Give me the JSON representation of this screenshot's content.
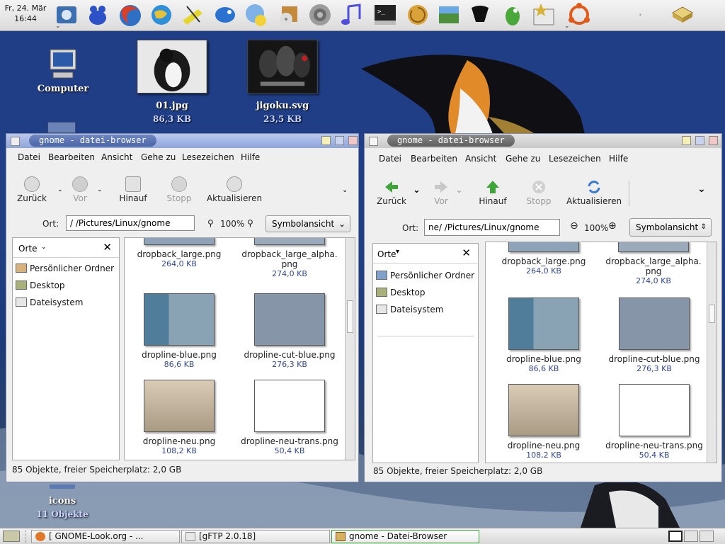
{
  "panel": {
    "date": "Fr, 24. Mär",
    "time": "16:44",
    "launchers": [
      {
        "name": "bookmarks-icon",
        "color": "#3b6fb0"
      },
      {
        "name": "frog-icon",
        "color": "#2d51c6"
      },
      {
        "name": "firefox-icon",
        "color": "#c0392b"
      },
      {
        "name": "web-globe-icon",
        "color": "#2f8fd8"
      },
      {
        "name": "gimp-icon",
        "color": "#d99b2a"
      },
      {
        "name": "notes-icon",
        "color": "#e5d630"
      },
      {
        "name": "fish-icon",
        "color": "#2a72d0"
      },
      {
        "name": "messenger-icon",
        "color": "#7fb2e6"
      },
      {
        "name": "cd-burner-icon",
        "color": "#c28a3a"
      },
      {
        "name": "speaker-icon",
        "color": "#9c9c9c"
      },
      {
        "name": "music-note-icon",
        "color": "#4e4edc"
      },
      {
        "name": "terminal-icon",
        "color": "#222222"
      },
      {
        "name": "nautilus-shell-icon",
        "color": "#d9a33a"
      },
      {
        "name": "image-editor-icon",
        "color": "#4d8f3a"
      },
      {
        "name": "inkscape-icon",
        "color": "#111111"
      },
      {
        "name": "gaim-bird-icon",
        "color": "#4aa83a"
      },
      {
        "name": "star-window-icon",
        "color": "#d6b23a"
      },
      {
        "name": "ubuntu-logo-icon",
        "color": "#e05a1c"
      }
    ]
  },
  "desktop": {
    "icons": [
      {
        "label": "Computer",
        "size": ""
      },
      {
        "label": "01.jpg",
        "size": "86,3 KB"
      },
      {
        "label": "jigoku.svg",
        "size": "23,5 KB"
      },
      {
        "label": "icons",
        "size": "11 Objekte"
      }
    ]
  },
  "left_window": {
    "title": "gnome - datei-browser",
    "menu": [
      "Datei",
      "Bearbeiten",
      "Ansicht",
      "Gehe zu",
      "Lesezeichen",
      "Hilfe"
    ],
    "toolbar": [
      "Zurück",
      "Vor",
      "Hinauf",
      "Stopp",
      "Aktualisieren"
    ],
    "location_label": "Ort:",
    "location_value": "/          /Pictures/Linux/gnome",
    "zoom": "100%",
    "view": "Symbolansicht",
    "sidebar_title": "Orte",
    "places": [
      "Persönlicher Ordner",
      "Desktop",
      "Dateisystem"
    ],
    "files": [
      {
        "name": "dropback_large.png",
        "size": "264,0 KB"
      },
      {
        "name": "dropback_large_alpha.\npng",
        "size": "274,0 KB"
      },
      {
        "name": "dropline-blue.png",
        "size": "86,6 KB"
      },
      {
        "name": "dropline-cut-blue.png",
        "size": "276,3 KB"
      },
      {
        "name": "dropline-neu.png",
        "size": "108,2 KB"
      },
      {
        "name": "dropline-neu-trans.png",
        "size": "50,4 KB"
      }
    ],
    "status": "85 Objekte, freier Speicherplatz: 2,0 GB"
  },
  "right_window": {
    "title": "gnome - datei-browser",
    "menu": [
      "Datei",
      "Bearbeiten",
      "Ansicht",
      "Gehe zu",
      "Lesezeichen",
      "Hilfe"
    ],
    "toolbar": [
      "Zurück",
      "Vor",
      "Hinauf",
      "Stopp",
      "Aktualisieren"
    ],
    "location_label": "Ort:",
    "location_value": "ne/          /Pictures/Linux/gnome",
    "zoom": "100%",
    "view": "Symbolansicht",
    "sidebar_title": "Orte",
    "places": [
      "Persönlicher Ordner",
      "Desktop",
      "Dateisystem"
    ],
    "files": [
      {
        "name": "dropback_large.png",
        "size": "264,0 KB"
      },
      {
        "name": "dropback_large_alpha.\npng",
        "size": "274,0 KB"
      },
      {
        "name": "dropline-blue.png",
        "size": "86,6 KB"
      },
      {
        "name": "dropline-cut-blue.png",
        "size": "276,3 KB"
      },
      {
        "name": "dropline-neu.png",
        "size": "108,2 KB"
      },
      {
        "name": "dropline-neu-trans.png",
        "size": "50,4 KB"
      }
    ],
    "status": "85 Objekte, freier Speicherplatz: 2,0 GB"
  },
  "taskbar": {
    "tasks": [
      {
        "label": "[               GNOME-Look.org - ...",
        "icon": "firefox-icon"
      },
      {
        "label": "[gFTP 2.0.18]",
        "icon": "gftp-icon"
      },
      {
        "label": "gnome - Datei-Browser",
        "icon": "file-manager-icon"
      }
    ]
  },
  "colors": {
    "left_titlebar": "#8fa5da",
    "right_titlebar": "#c8c8c8",
    "desktop_blue": "#203f85",
    "active_task_border": "#3aa43a"
  }
}
